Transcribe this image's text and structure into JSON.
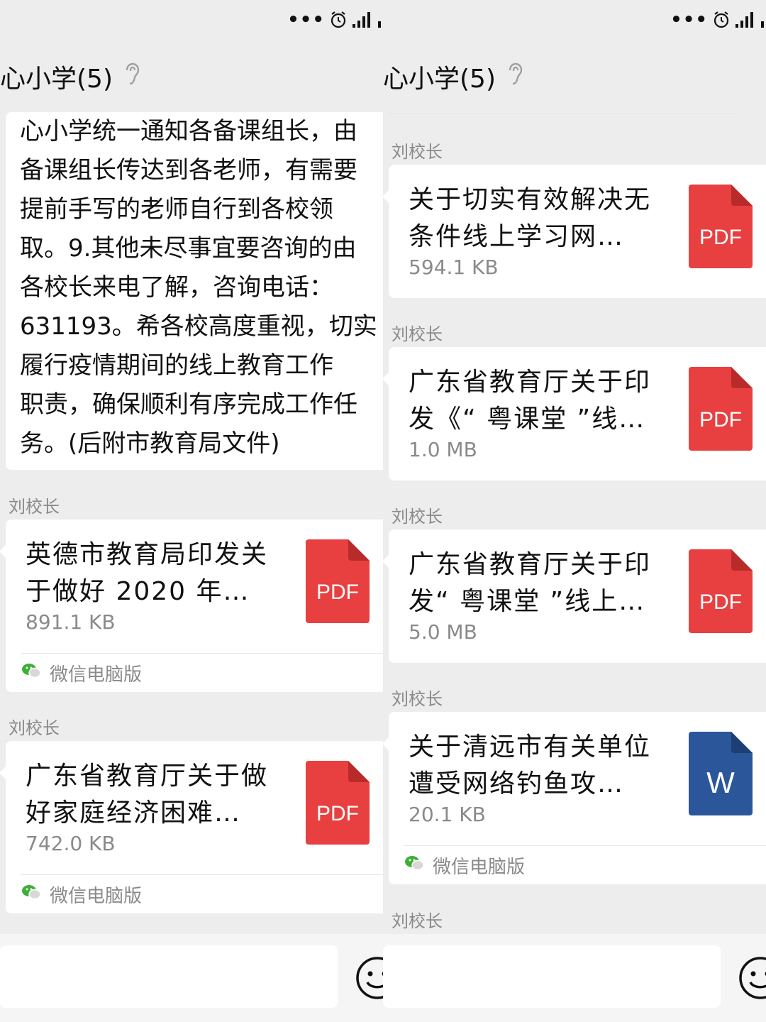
{
  "status": {
    "dots": "•••"
  },
  "header": {
    "title": "心小学(5)"
  },
  "left": {
    "message_lines": [
      "心小学统一通知各备课组长，由",
      "备课组长传达到各老师，有需要",
      "提前手写的老师自行到各校领",
      "取。9.其他未尽事宜要咨询的由",
      "各校长来电了解，咨询电话：",
      "631193。希各校高度重视，切实",
      "履行疫情期间的线上教育工作",
      "职责，确保顺利有序完成工作任",
      "务。(后附市教育局文件)"
    ],
    "files": [
      {
        "sender": "刘校长",
        "title": "英德市教育局印发关于做好 2020 年…",
        "size": "891.1 KB",
        "type": "PDF",
        "source": "微信电脑版"
      },
      {
        "sender": "刘校长",
        "title": "广东省教育厅关于做好家庭经济困难…",
        "size": "742.0 KB",
        "type": "PDF",
        "source": "微信电脑版"
      }
    ]
  },
  "right": {
    "files": [
      {
        "sender": "刘校长",
        "title": "关于切实有效解决无条件线上学习网…",
        "size": "594.1 KB",
        "type": "PDF"
      },
      {
        "sender": "刘校长",
        "title": "广东省教育厅关于印发《“ 粤课堂 ”线…",
        "size": "1.0 MB",
        "type": "PDF"
      },
      {
        "sender": "刘校长",
        "title": "广东省教育厅关于印发“ 粤课堂 ”线上…",
        "size": "5.0 MB",
        "type": "PDF"
      },
      {
        "sender": "刘校长",
        "title": "关于清远市有关单位遭受网络钓鱼攻…",
        "size": "20.1 KB",
        "type": "W",
        "source": "微信电脑版"
      }
    ],
    "trailing_sender": "刘校长"
  },
  "colors": {
    "pdf": "#e84040",
    "word": "#2b579a",
    "background": "#ededed",
    "muted": "#8a8a8a"
  }
}
